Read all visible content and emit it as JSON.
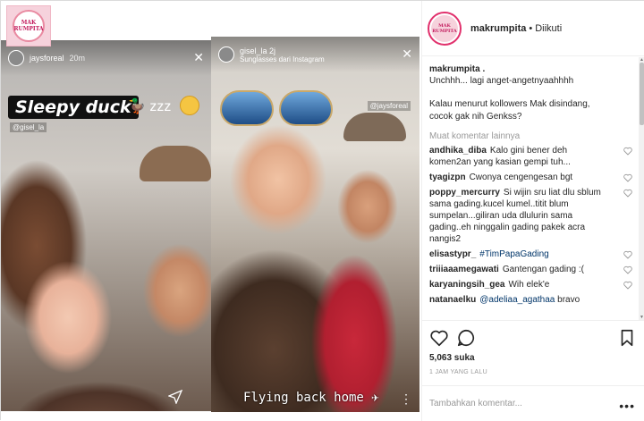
{
  "watermark": {
    "logo_text": "MAK RUMPITA"
  },
  "story_left": {
    "username": "jaysforeal",
    "time": "20m",
    "sticker_text": "Sleepy duck",
    "sticker_emoji": "🦆 zzz",
    "mention": "@gisel_la"
  },
  "story_right": {
    "username": "gisel_la",
    "time": "2j",
    "subtitle": "Sunglasses dari Instagram",
    "mention": "@jaysforeal",
    "caption": "Flying back home"
  },
  "header": {
    "username": "makrumpita",
    "separator": "•",
    "follow_status": "Diikuti",
    "avatar_text": "MAK RUMPITA"
  },
  "caption": {
    "username": "makrumpita .",
    "line1": "Unchhh... lagi anget-angetnyaahhhh",
    "line2": "Kalau menurut kollowers Mak disindang,",
    "line3": "cocok gak nih Genkss?"
  },
  "load_more": "Muat komentar lainnya",
  "comments": [
    {
      "user": "andhika_diba",
      "text": "Kalo gini bener deh komen2an yang kasian gempi tuh..."
    },
    {
      "user": "tyagizpn",
      "text": "Cwonya cengengesan bgt"
    },
    {
      "user": "poppy_mercurry",
      "text": "Si wijin sru liat dlu sblum sama gading.kucel kumel..titit blum sumpelan...giliran uda dlulurin sama gading..eh ninggalin gading pakek acra nangis2"
    },
    {
      "user": "elisastypr_",
      "tag": "#TimPapaGading",
      "text": ""
    },
    {
      "user": "triiiaaamegawati",
      "text": "Gantengan gading :("
    },
    {
      "user": "karyaningsih_gea",
      "text": "Wih elek'e"
    },
    {
      "user": "natanaelku",
      "tag": "@adeliaa_agathaa",
      "text": "bravo"
    }
  ],
  "likes": "5,063 suka",
  "timestamp": "1 JAM YANG LALU",
  "add_comment": {
    "placeholder": "Tambahkan komentar...",
    "more": "•••"
  }
}
